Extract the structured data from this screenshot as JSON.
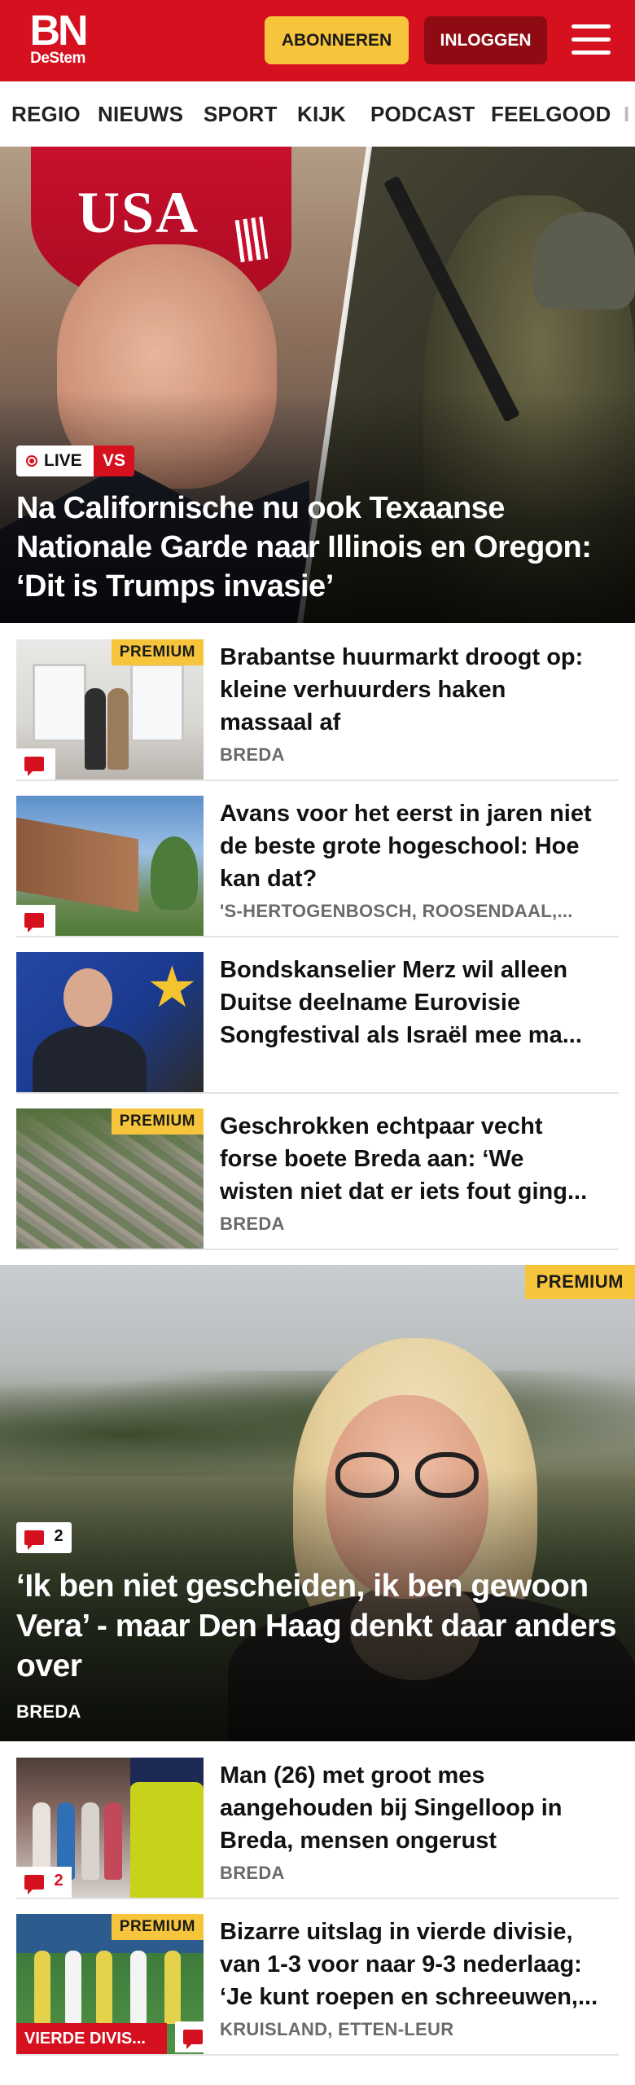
{
  "header": {
    "logo_main": "BN",
    "logo_sub": "DeStem",
    "subscribe_label": "ABONNEREN",
    "login_label": "INLOGGEN",
    "menu_icon": "hamburger-menu-icon",
    "brand_color": "#d5101f",
    "subscribe_color": "#f6c53b",
    "login_color": "#8e0b13"
  },
  "nav": {
    "items": [
      "REGIO",
      "NIEUWS",
      "SPORT",
      "KIJK",
      "PODCAST",
      "FEELGOOD",
      "I"
    ]
  },
  "hero": {
    "live_label": "LIVE",
    "country_tag": "VS",
    "cap_text": "USA",
    "title": "Na Californische nu ook Texaanse Nationale Garde naar Illinois en Oregon: ‘Dit is Trumps invasie’"
  },
  "articles": [
    {
      "title": "Brabantse huurmarkt droogt op: kleine verhuurders haken massaal af",
      "location": "BREDA",
      "premium": "PREMIUM",
      "has_comments": true
    },
    {
      "title": "Avans voor het eerst in jaren niet de beste grote hogeschool: Hoe kan dat?",
      "location": "'S-HERTOGENBOSCH, ROOSENDAAL,...",
      "has_comments": true
    },
    {
      "title": "Bondskanselier Merz wil alleen Duitse deelname Eurovisie Songfestival als Israël mee ma..."
    },
    {
      "title": "Geschrokken echtpaar vecht forse boete Breda aan: ‘We wisten niet dat er iets fout ging...",
      "location": "BREDA",
      "premium": "PREMIUM"
    }
  ],
  "feature": {
    "premium": "PREMIUM",
    "comment_count": "2",
    "title": "‘Ik ben niet gescheiden, ik ben gewoon Vera’ - maar Den Haag denkt daar anders over",
    "location": "BREDA"
  },
  "articles2": [
    {
      "title": "Man (26) met groot mes aangehouden bij Singelloop in Breda, mensen ongerust",
      "location": "BREDA",
      "comment_count": "2"
    },
    {
      "title": "Bizarre uitslag in vierde divisie, van 1-3 voor naar 9-3 nederlaag: ‘Je kunt roepen en schreeuwen,...",
      "location": "KRUISLAND, ETTEN-LEUR",
      "premium": "PREMIUM",
      "category": "VIERDE DIVIS..."
    }
  ],
  "icons": {
    "comment": "comment-bubble-icon",
    "live": "live-dot-icon"
  }
}
